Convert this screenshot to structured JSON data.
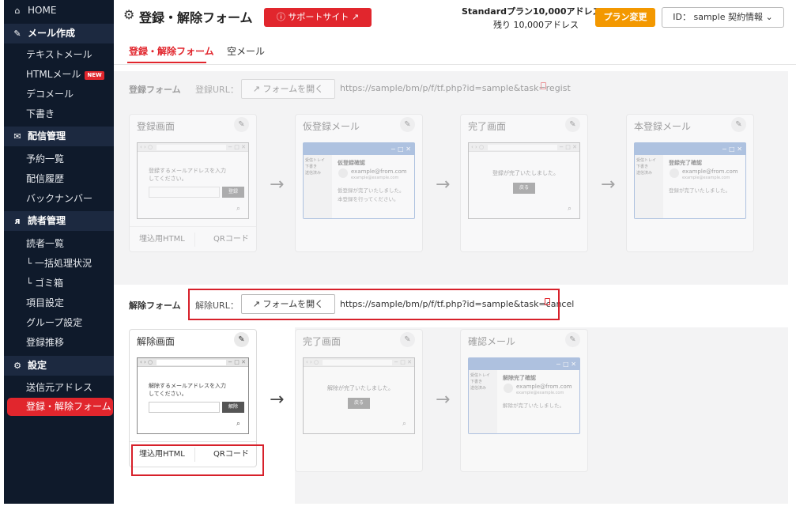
{
  "sidebar": {
    "home": "HOME",
    "mail_section": "メール作成",
    "text_mail": "テキストメール",
    "html_mail": "HTMLメール",
    "new_badge": "NEW",
    "deco_mail": "デコメール",
    "draft": "下書き",
    "delivery_section": "配信管理",
    "reservation_list": "予約一覧",
    "delivery_history": "配信履歴",
    "back_number": "バックナンバー",
    "reader_section": "読者管理",
    "reader_list": "読者一覧",
    "batch_status": "└ 一括処理状況",
    "trash": "└ ゴミ箱",
    "field_settings": "項目設定",
    "group_settings": "グループ設定",
    "registration_trend": "登録推移",
    "settings_section": "設定",
    "sender_address": "送信元アドレス",
    "form_active": "登録・解除フォーム"
  },
  "header": {
    "title": "登録・解除フォーム",
    "support_label": "サポートサイト",
    "plan_line1": "Standardプラン10,000アドレス",
    "plan_line2": "残り 10,000アドレス",
    "plan_change": "プラン変更",
    "account": "ID： sample  契約情報"
  },
  "tabs": {
    "register_cancel": "登録・解除フォーム",
    "empty_mail": "空メール"
  },
  "register": {
    "label": "登録フォーム",
    "url_label": "登録URL：",
    "open_form": "フォームを開く",
    "url": "https://sample/bm/p/f/tf.php?id=sample&task=regist",
    "cards": {
      "screen_title": "登録画面",
      "screen_text": "登録するメールアドレスを入力してください。",
      "screen_btn": "登録",
      "temp_mail_title": "仮登録メール",
      "temp_mail_subject": "仮登録確認",
      "temp_mail_body1": "仮登録が完了いたしました。",
      "temp_mail_body2": "本登録を行ってください。",
      "complete_title": "完了画面",
      "complete_text": "登録が完了いたしました。",
      "complete_btn": "戻る",
      "final_mail_title": "本登録メール",
      "final_mail_subject": "登録完了確認",
      "final_mail_body": "登録が完了いたしました。"
    },
    "embed_html": "埋込用HTML",
    "qr_code": "QRコード"
  },
  "cancel": {
    "label": "解除フォーム",
    "url_label": "解除URL：",
    "open_form": "フォームを開く",
    "url": "https://sample/bm/p/f/tf.php?id=sample&task=cancel",
    "cards": {
      "screen_title": "解除画面",
      "screen_text": "解除するメールアドレスを入力してください。",
      "screen_btn": "解除",
      "complete_title": "完了画面",
      "complete_text": "解除が完了いたしました。",
      "complete_btn": "戻る",
      "confirm_mail_title": "確認メール",
      "confirm_mail_subject": "解除完了確認",
      "confirm_mail_body": "解除が完了いたしました。"
    },
    "embed_html": "埋込用HTML",
    "qr_code": "QRコード"
  },
  "mail_common": {
    "inbox": "受信トレイ",
    "draft": "下書き",
    "sent": "送信済み",
    "from": "example@from.com",
    "from_sub": "example@example.com",
    "window_controls": "− □ ✕",
    "browser_nav": "‹ › ○"
  },
  "icons": {
    "home": "home-icon",
    "mail": "pencil-icon",
    "delivery": "envelope-icon",
    "reader": "people-icon",
    "settings": "gear-icon",
    "edit": "edit-pencil-icon",
    "search": "search-icon",
    "copy": "copy-icon",
    "external": "external-link-icon",
    "arrow": "right-arrow-icon"
  },
  "colors": {
    "brand_red": "#e1262d",
    "plan_orange": "#f39800",
    "sidebar_bg": "#0f1a2b",
    "mail_blue": "#5b86c7"
  }
}
